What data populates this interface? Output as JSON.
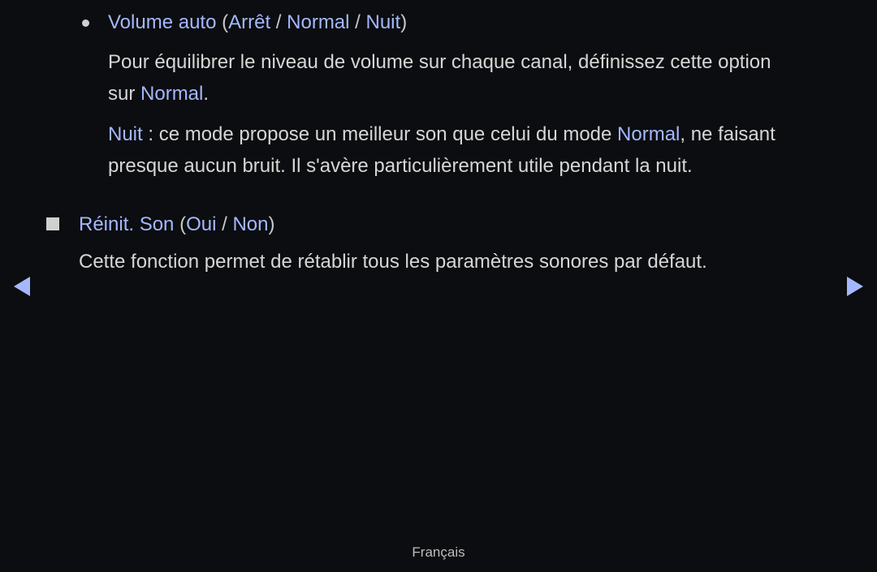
{
  "section1": {
    "title": "Volume auto",
    "options": [
      "Arrêt",
      "Normal",
      "Nuit"
    ],
    "para1_text": "Pour équilibrer le niveau de volume sur chaque canal, définissez cette option",
    "para1_line2_prefix": "sur ",
    "para1_highlight": "Normal",
    "para1_suffix": ".",
    "para2_highlight1": "Nuit",
    "para2_text1": " : ce mode propose un meilleur son que celui du mode ",
    "para2_highlight2": "Normal",
    "para2_text2": ", ne faisant",
    "para2_line2": "presque aucun bruit. Il s'avère particulièrement utile pendant la nuit."
  },
  "section2": {
    "title": "Réinit. Son",
    "options": [
      "Oui",
      "Non"
    ],
    "description": "Cette fonction permet de rétablir tous les paramètres sonores par défaut."
  },
  "navigation": {
    "prev_icon": "triangle-left",
    "next_icon": "triangle-right"
  },
  "footer": {
    "language": "Français"
  },
  "colors": {
    "highlight": "#a4b8ff",
    "text": "#d6d6d6",
    "background": "#0c0d10"
  }
}
